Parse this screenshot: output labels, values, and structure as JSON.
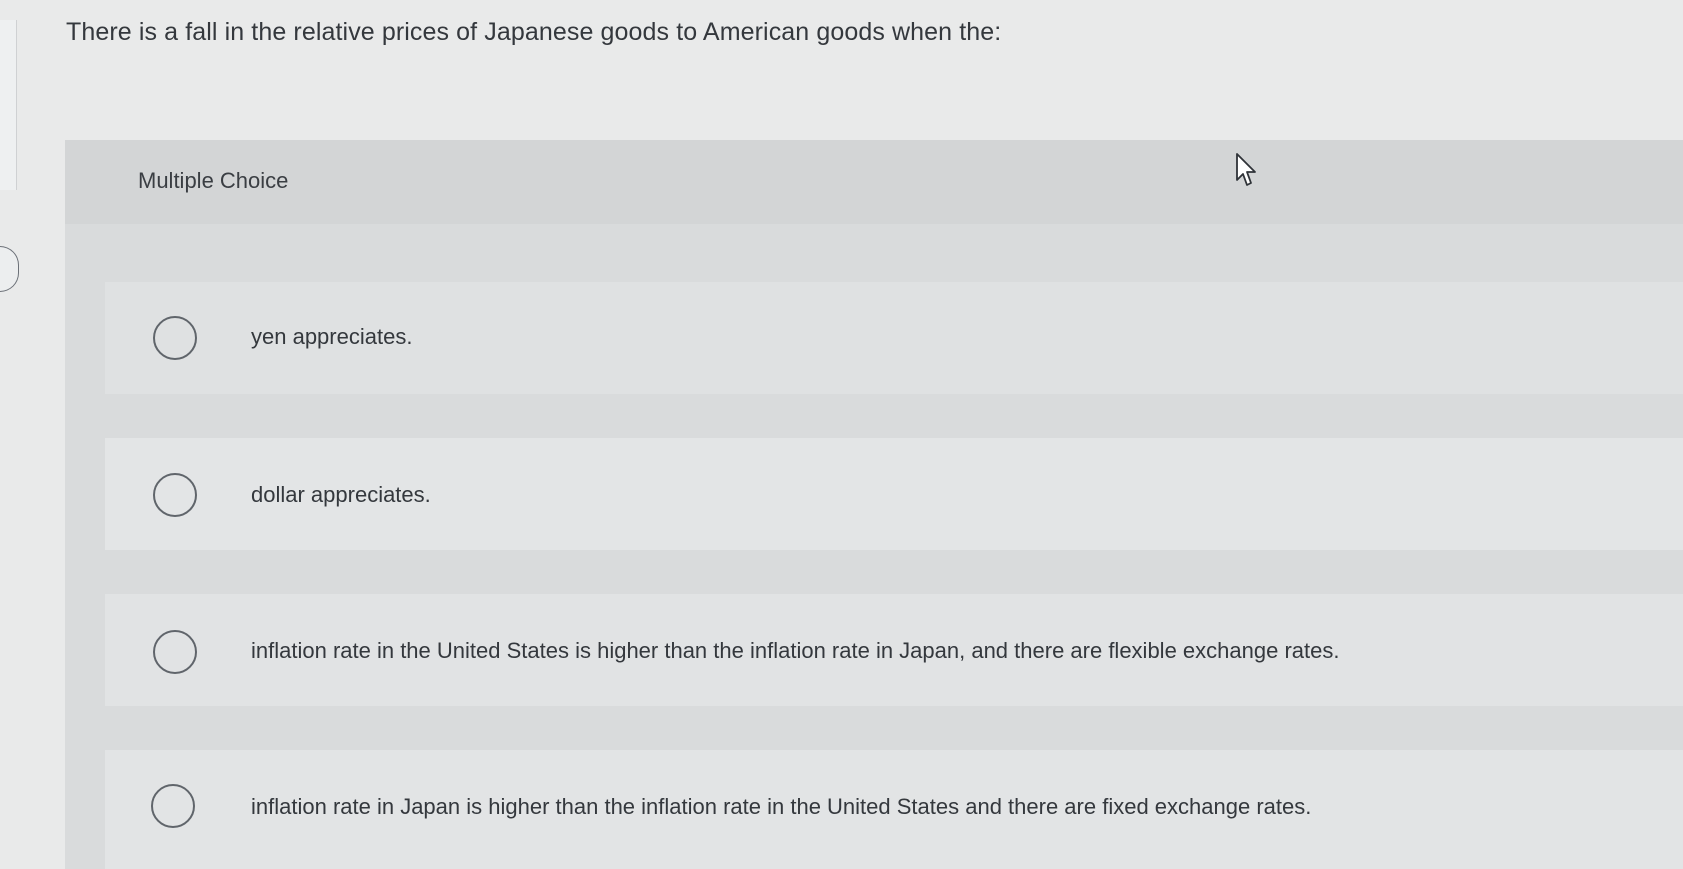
{
  "question": {
    "text": "There is a fall in the relative prices of Japanese goods to American goods when the:"
  },
  "multiple_choice": {
    "label": "Multiple Choice",
    "options": [
      {
        "text": "yen appreciates."
      },
      {
        "text": "dollar appreciates."
      },
      {
        "text": "inflation rate in the United States is higher than the inflation rate in Japan, and there are flexible exchange rates."
      },
      {
        "text": "inflation rate in Japan is higher than the inflation rate in the United States and there are fixed exchange rates."
      }
    ]
  },
  "icons": {
    "cursor": "mouse-pointer-icon",
    "radio": "radio-unselected-icon"
  },
  "colors": {
    "background": "#e9eaea",
    "panel": "#d9dbdc",
    "option": "#e1e3e4",
    "text": "#34383d",
    "radio_border": "#60656b"
  }
}
